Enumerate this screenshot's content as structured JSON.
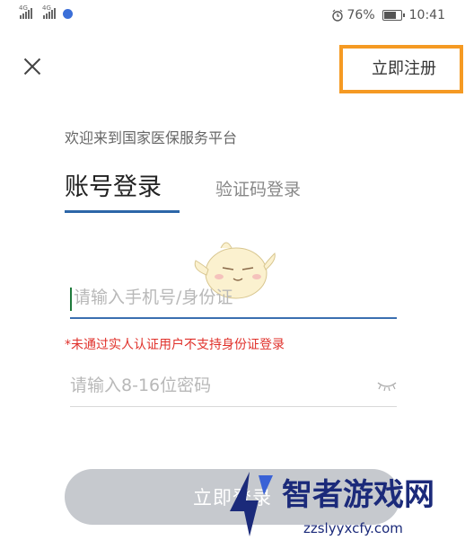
{
  "status_bar": {
    "signal_1_tag": "4G",
    "signal_2_tag": "4G",
    "battery": "76%",
    "time": "10:41"
  },
  "header": {
    "register_label": "立即注册"
  },
  "welcome_text": "欢迎来到国家医保服务平台",
  "tabs": {
    "account": "账号登录",
    "sms": "验证码登录"
  },
  "form": {
    "phone_placeholder": "请输入手机号/身份证",
    "warning": "*未通过实人认证用户不支持身份证登录",
    "password_placeholder": "请输入8-16位密码",
    "submit_label": "立即登录"
  },
  "watermark": {
    "title": "智者游戏网",
    "url": "zzslyyxcfy.com"
  },
  "colors": {
    "accent_blue": "#2c66a8",
    "highlight_orange": "#f59a23",
    "warning_red": "#e0312b",
    "button_disabled": "#c6c9ce"
  }
}
